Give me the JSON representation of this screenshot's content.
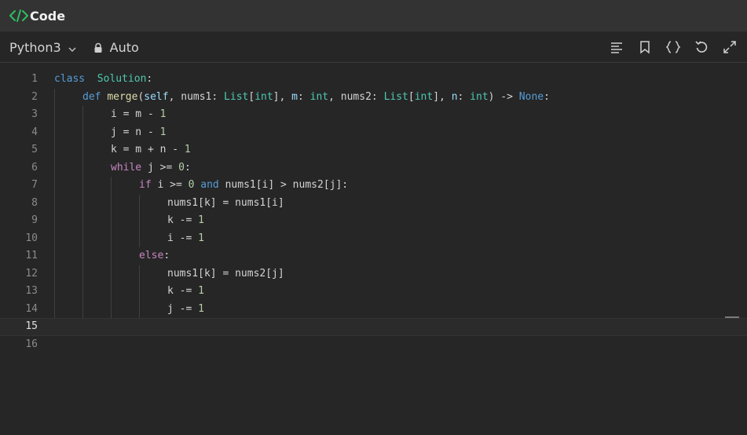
{
  "header": {
    "title": "Code",
    "icon": "code-icon"
  },
  "toolbar": {
    "language": "Python3",
    "mode": "Auto",
    "tools": [
      "format-icon",
      "bookmark-icon",
      "braces-icon",
      "reset-icon",
      "expand-icon"
    ]
  },
  "editor": {
    "current_line": 15,
    "lines": [
      {
        "n": "1",
        "indent": 0,
        "tokens": [
          [
            "kw2",
            "class"
          ],
          [
            "",
            "  "
          ],
          [
            "cls",
            "Solution"
          ],
          [
            "",
            ":"
          ]
        ]
      },
      {
        "n": "2",
        "indent": 1,
        "tokens": [
          [
            "kw2",
            "def"
          ],
          [
            "",
            " "
          ],
          [
            "fn",
            "merge"
          ],
          [
            "",
            "("
          ],
          [
            "self",
            "self"
          ],
          [
            "",
            ", nums1: "
          ],
          [
            "typ",
            "List"
          ],
          [
            "",
            "["
          ],
          [
            "typ",
            "int"
          ],
          [
            "",
            "], "
          ],
          [
            "self",
            "m"
          ],
          [
            "",
            ": "
          ],
          [
            "typ",
            "int"
          ],
          [
            "",
            ", nums2: "
          ],
          [
            "typ",
            "List"
          ],
          [
            "",
            "["
          ],
          [
            "typ",
            "int"
          ],
          [
            "",
            "], "
          ],
          [
            "self",
            "n"
          ],
          [
            "",
            ": "
          ],
          [
            "typ",
            "int"
          ],
          [
            "",
            ") -> "
          ],
          [
            "kw2",
            "None"
          ],
          [
            "",
            ":"
          ]
        ]
      },
      {
        "n": "3",
        "indent": 2,
        "tokens": [
          [
            "",
            "i = m - "
          ],
          [
            "num",
            "1"
          ]
        ]
      },
      {
        "n": "4",
        "indent": 2,
        "tokens": [
          [
            "",
            "j = n - "
          ],
          [
            "num",
            "1"
          ]
        ]
      },
      {
        "n": "5",
        "indent": 2,
        "tokens": [
          [
            "",
            "k = m + n - "
          ],
          [
            "num",
            "1"
          ]
        ]
      },
      {
        "n": "6",
        "indent": 2,
        "tokens": [
          [
            "kw",
            "while"
          ],
          [
            "",
            " j >= "
          ],
          [
            "num",
            "0"
          ],
          [
            "",
            ":"
          ]
        ]
      },
      {
        "n": "7",
        "indent": 3,
        "tokens": [
          [
            "kw",
            "if"
          ],
          [
            "",
            " i >= "
          ],
          [
            "num",
            "0"
          ],
          [
            "",
            " "
          ],
          [
            "kw2",
            "and"
          ],
          [
            "",
            " nums1[i] > nums2[j]:"
          ]
        ]
      },
      {
        "n": "8",
        "indent": 4,
        "tokens": [
          [
            "",
            "nums1[k] = nums1[i]"
          ]
        ]
      },
      {
        "n": "9",
        "indent": 4,
        "tokens": [
          [
            "",
            "k -= "
          ],
          [
            "num",
            "1"
          ]
        ]
      },
      {
        "n": "10",
        "indent": 4,
        "tokens": [
          [
            "",
            "i -= "
          ],
          [
            "num",
            "1"
          ]
        ]
      },
      {
        "n": "11",
        "indent": 3,
        "tokens": [
          [
            "kw",
            "else"
          ],
          [
            "",
            ":"
          ]
        ]
      },
      {
        "n": "12",
        "indent": 4,
        "tokens": [
          [
            "",
            "nums1[k] = nums2[j]"
          ]
        ]
      },
      {
        "n": "13",
        "indent": 4,
        "tokens": [
          [
            "",
            "k -= "
          ],
          [
            "num",
            "1"
          ]
        ]
      },
      {
        "n": "14",
        "indent": 4,
        "tokens": [
          [
            "",
            "j -= "
          ],
          [
            "num",
            "1"
          ]
        ]
      },
      {
        "n": "15",
        "indent": 0,
        "tokens": []
      },
      {
        "n": "16",
        "indent": 0,
        "tokens": []
      }
    ]
  },
  "colors": {
    "accent_green": "#2dbe60",
    "background": "#262626",
    "header": "#333333"
  }
}
